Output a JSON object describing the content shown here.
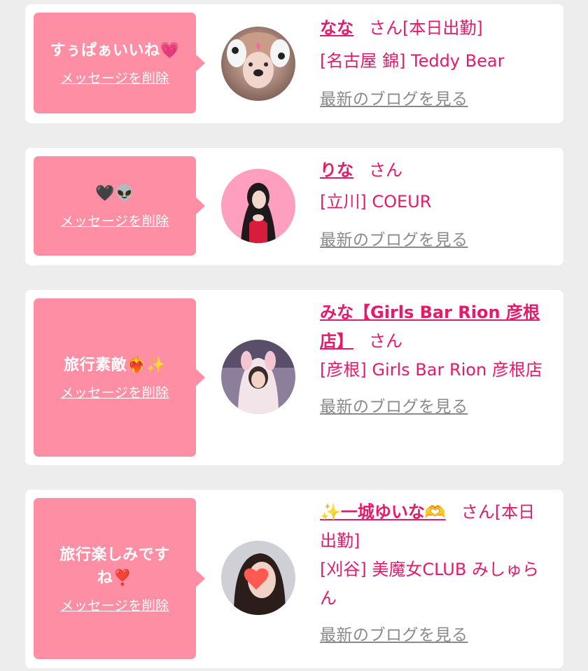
{
  "items": [
    {
      "message": "すぅぱぁいいね💗",
      "delete_label": "メッセージを削除",
      "name": "なな",
      "honorific": "さん",
      "status": "[本日出勤]",
      "shop": "[名古屋 錦] Teddy Bear",
      "blog_label": "最新のブログを見る"
    },
    {
      "message": "🖤👽",
      "delete_label": "メッセージを削除",
      "name": "りな",
      "honorific": "さん",
      "status": "",
      "shop": "[立川] COEUR",
      "blog_label": "最新のブログを見る"
    },
    {
      "message": "旅行素敵❤️‍🔥✨",
      "delete_label": "メッセージを削除",
      "name": "みな【Girls Bar Rion 彦根店】",
      "honorific": "さん",
      "status": "",
      "shop": "[彦根] Girls Bar Rion 彦根店",
      "blog_label": "最新のブログを見る"
    },
    {
      "message": "旅行楽しみですね❣️",
      "delete_label": "メッセージを削除",
      "name": "✨一城ゆいな🫶",
      "honorific": "さん",
      "status": "[本日出勤]",
      "shop": "[刈谷] 美魔女CLUB みしゅらん",
      "blog_label": "最新のブログを見る"
    }
  ],
  "colors": {
    "bubble": "#fd8ea4",
    "accent": "#e8196a",
    "link_gray": "#8a8a8a"
  }
}
